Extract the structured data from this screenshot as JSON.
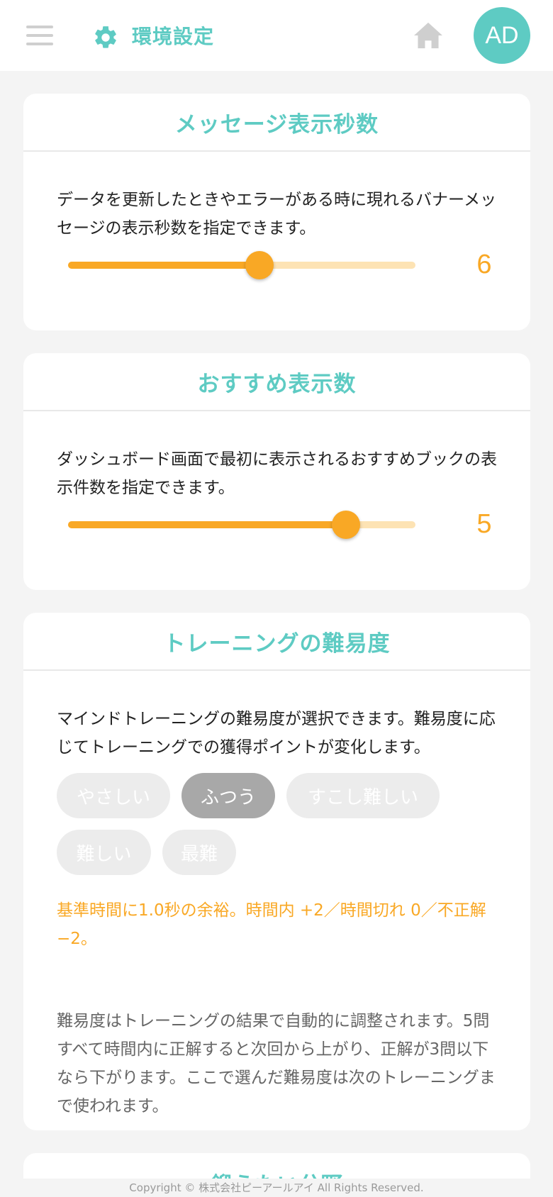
{
  "header": {
    "title": "環境設定",
    "avatar_initials": "AD"
  },
  "message_seconds": {
    "title": "メッセージ表示秒数",
    "description": "データを更新したときやエラーがある時に現れるバナーメッセージの表示秒数を指定できます。",
    "value": "6",
    "slider_fraction": 0.55
  },
  "recommend_count": {
    "title": "おすすめ表示数",
    "description": "ダッシュボード画面で最初に表示されるおすすめブックの表示件数を指定できます。",
    "value": "5",
    "slider_fraction": 0.8
  },
  "difficulty": {
    "title": "トレーニングの難易度",
    "description": "マインドトレーニングの難易度が選択できます。難易度に応じてトレーニングでの獲得ポイントが変化します。",
    "options": [
      "やさしい",
      "ふつう",
      "すこし難しい",
      "難しい",
      "最難"
    ],
    "selected": "ふつう",
    "rule_text": "基準時間に1.0秒の余裕。時間内 +2／時間切れ 0／不正解 −2。",
    "note_text": "難易度はトレーニングの結果で自動的に調整されます。5問すべて時間内に正解すると次回から上がり、正解が3問以下なら下がります。ここで選んだ難易度は次のトレーニングまで使われます。"
  },
  "next_section": {
    "title_partial": "鍛えたい分野"
  },
  "footer": {
    "copyright": "Copyright © 株式会社ピーアールアイ All Rights Reserved."
  },
  "colors": {
    "accent_teal": "#5ecbc3",
    "slider_orange": "#f9a825",
    "slider_track": "#fde3b4",
    "pill_active": "#a8a8a8",
    "pill_inactive": "#ececec"
  }
}
